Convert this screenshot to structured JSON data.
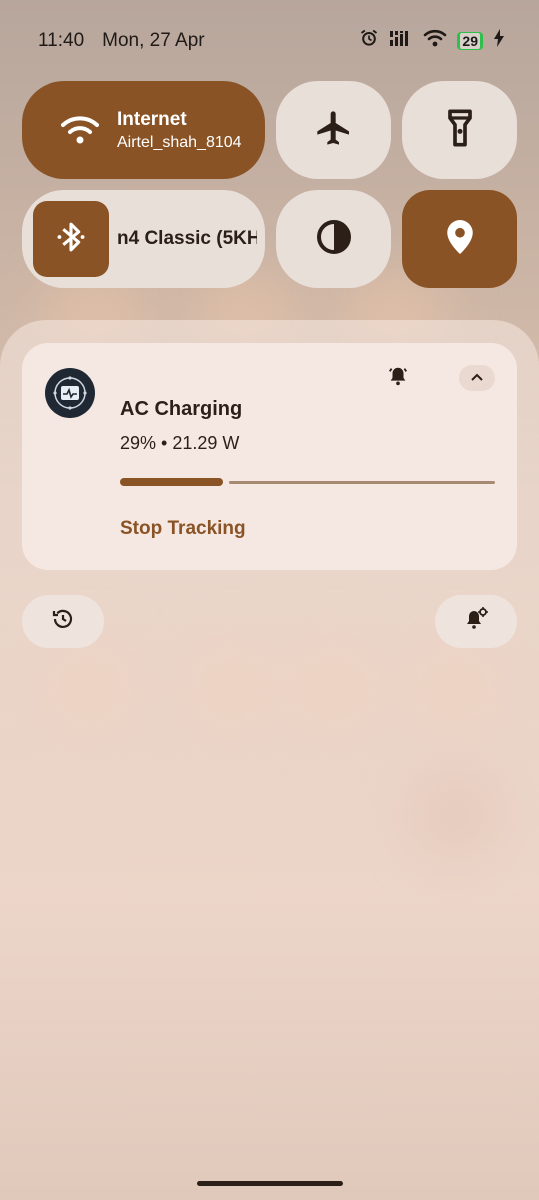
{
  "status_bar": {
    "time": "11:40",
    "date": "Mon, 27 Apr",
    "battery_level": "29",
    "icons": [
      "alarm-icon",
      "signal-icon",
      "wifi-icon",
      "battery-icon",
      "charging-bolt-icon"
    ]
  },
  "quick_settings": {
    "internet": {
      "title": "Internet",
      "subtitle": "Airtel_shah_8104",
      "state": "on",
      "icon": "wifi-icon"
    },
    "airplane": {
      "icon": "airplane-icon",
      "state": "off"
    },
    "flashlight": {
      "icon": "flashlight-icon",
      "state": "off"
    },
    "bluetooth": {
      "label": "n4 Classic (5KH",
      "icon": "bluetooth-icon",
      "state": "on"
    },
    "dark_theme": {
      "icon": "contrast-icon",
      "state": "off"
    },
    "location": {
      "icon": "location-icon",
      "state": "on"
    }
  },
  "notification": {
    "title": "AC Charging",
    "subtitle": "29% • 21.29 W",
    "progress_fraction": 0.29,
    "action": "Stop Tracking",
    "icons": [
      "app-icon",
      "bell-alert-icon",
      "chevron-up-icon"
    ]
  },
  "bottom_buttons": [
    "history-icon",
    "notification-settings-icon"
  ],
  "colors": {
    "accent": "#8a5325",
    "tile_off": "#e9dfd9",
    "card": "#f5e8e2"
  }
}
